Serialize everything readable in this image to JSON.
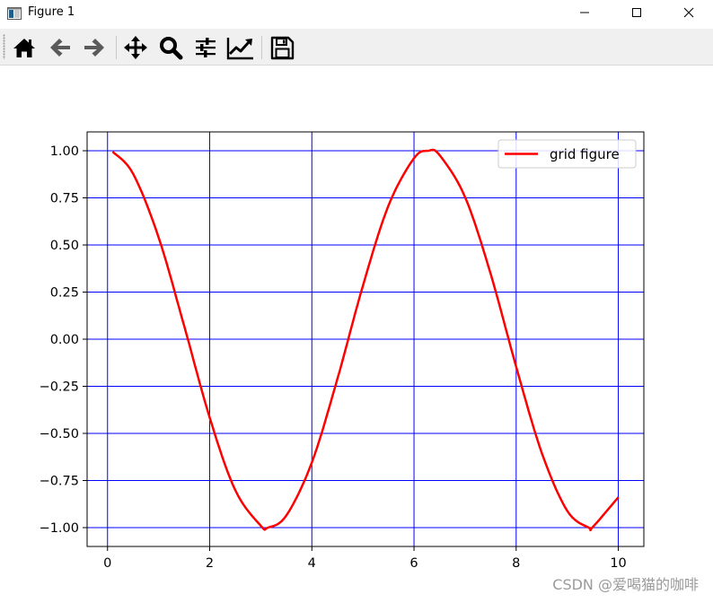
{
  "window": {
    "title": "Figure 1",
    "icon": "matplotlib-figure-icon",
    "controls": [
      "minimize-icon",
      "maximize-icon",
      "close-icon"
    ]
  },
  "toolbar": {
    "buttons": [
      {
        "name": "home",
        "icon": "home-icon"
      },
      {
        "name": "back",
        "icon": "arrow-left-icon"
      },
      {
        "name": "forward",
        "icon": "arrow-right-icon"
      },
      {
        "name": "pan",
        "icon": "move-icon"
      },
      {
        "name": "zoom",
        "icon": "magnifier-icon"
      },
      {
        "name": "subplots",
        "icon": "sliders-icon"
      },
      {
        "name": "customize",
        "icon": "line-chart-icon"
      },
      {
        "name": "save",
        "icon": "floppy-disk-icon"
      }
    ]
  },
  "chart_data": {
    "type": "line",
    "title": "",
    "xlabel": "",
    "ylabel": "",
    "xlim": [
      -0.4,
      10.5
    ],
    "ylim": [
      -1.1,
      1.1
    ],
    "xticks": [
      0,
      2,
      4,
      6,
      8,
      10
    ],
    "xtick_labels": [
      "0",
      "2",
      "4",
      "6",
      "8",
      "10"
    ],
    "yticks": [
      1.0,
      0.75,
      0.5,
      0.25,
      0.0,
      -0.25,
      -0.5,
      -0.75,
      -1.0
    ],
    "ytick_labels": [
      "1.00",
      "0.75",
      "0.50",
      "0.25",
      "0.00",
      "−0.25",
      "−0.50",
      "−0.75",
      "−1.00"
    ],
    "grid": true,
    "grid_color": "#0000ff",
    "legend_position": "top-right",
    "series": [
      {
        "name": "grid figure",
        "color": "#ff0000",
        "x": [
          0.1,
          0.5,
          1.0,
          1.5,
          2.0,
          2.5,
          3.0,
          3.14,
          3.5,
          4.0,
          4.5,
          5.0,
          5.5,
          6.0,
          6.28,
          6.5,
          7.0,
          7.5,
          8.0,
          8.5,
          9.0,
          9.42,
          9.5,
          10.0
        ],
        "y": [
          0.995,
          0.878,
          0.54,
          0.071,
          -0.416,
          -0.801,
          -0.99,
          -1.0,
          -0.936,
          -0.654,
          -0.211,
          0.284,
          0.709,
          0.96,
          1.0,
          0.977,
          0.754,
          0.347,
          -0.146,
          -0.602,
          -0.911,
          -1.0,
          -0.997,
          -0.839
        ]
      }
    ]
  },
  "watermark": "CSDN @爱喝猫的咖啡"
}
